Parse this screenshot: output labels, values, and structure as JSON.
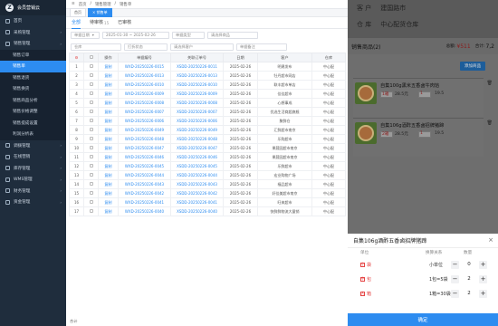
{
  "app": {
    "logo_text": "会员营销云"
  },
  "sidebar": {
    "items": [
      {
        "label": "首页"
      },
      {
        "label": "采购管理"
      },
      {
        "label": "销售管理"
      },
      {
        "label": "销售订单",
        "sub": true
      },
      {
        "label": "销售单",
        "sub": true,
        "active": true
      },
      {
        "label": "销售退货",
        "sub": true
      },
      {
        "label": "销售换货",
        "sub": true
      },
      {
        "label": "销售商品分析",
        "sub": true
      },
      {
        "label": "销售价格调整",
        "sub": true
      },
      {
        "label": "销售提成设置",
        "sub": true
      },
      {
        "label": "利润分析表",
        "sub": true
      },
      {
        "label": "调拨管理"
      },
      {
        "label": "在线营销"
      },
      {
        "label": "库存管理"
      },
      {
        "label": "WMS管理"
      },
      {
        "label": "财务管理"
      },
      {
        "label": "资金管理"
      }
    ]
  },
  "topbar": {
    "crumbs": [
      "首页",
      "/",
      "销售管理",
      "/",
      "销售单"
    ]
  },
  "tabs": [
    "首页",
    "× 销售单"
  ],
  "subtabs": [
    "全部",
    "待审核",
    "已审核"
  ],
  "subtab_badge": "15",
  "filters": {
    "date_type": "单据日期",
    "date_range": "2025-01-30  ~  2025-02-26",
    "bill_type": "单据类型",
    "keyword_ph": "请选择商品",
    "warehouse": "仓库",
    "status": "打折状态",
    "customer_ph": "请选择客户",
    "remark_ph": "单据备注"
  },
  "table": {
    "headers": [
      "",
      "",
      "操作",
      "单据编号",
      "关联订单号",
      "日期",
      "客户",
      "仓库"
    ],
    "rows": [
      [
        "1",
        "",
        "复制",
        "WXD-20250226-0015",
        "XSDD-20250226-0011",
        "2025-02-26",
        "明建发布",
        "中心配"
      ],
      [
        "2",
        "",
        "复制",
        "WXD-20250226-0013",
        "XSDD-20250226-0013",
        "2025-02-26",
        "牡丹超市网店",
        "中心配"
      ],
      [
        "3",
        "",
        "复制",
        "WXD-20250226-0010",
        "XSDD-20250226-0010",
        "2025-02-26",
        "联丰超市单店",
        "中心配"
      ],
      [
        "4",
        "",
        "复制",
        "WXD-20250226-0009",
        "XSDD-20250226-0009",
        "2025-02-26",
        "佳佳超市",
        "中心配"
      ],
      [
        "5",
        "",
        "复制",
        "WXD-20250226-0008",
        "XSDD-20250226-0008",
        "2025-02-26",
        "心想事成",
        "中心配"
      ],
      [
        "6",
        "",
        "复制",
        "WXD-20250226-0007",
        "XSDD-20250226-0007",
        "2025-02-26",
        "优选生活商超旗舰",
        "中心配"
      ],
      [
        "7",
        "",
        "复制",
        "WXD-20250226-0006",
        "XSDD-20250226-0006",
        "2025-02-26",
        "聚鲜仓",
        "中心配"
      ],
      [
        "8",
        "",
        "复制",
        "WXD-20250226-0049",
        "XSDD-20250226-0049",
        "2025-02-26",
        "汇鲜超市南京",
        "中心配"
      ],
      [
        "9",
        "",
        "复制",
        "WXD-20250226-0048",
        "XSDD-20250226-0048",
        "2025-02-26",
        "乐购超市",
        "中心配"
      ],
      [
        "10",
        "",
        "复制",
        "WXD-20250226-0047",
        "XSDD-20250226-0047",
        "2025-02-26",
        "果蔬园超市南京",
        "中心配"
      ],
      [
        "11",
        "",
        "复制",
        "WXD-20250226-0046",
        "XSDD-20250226-0046",
        "2025-02-26",
        "果蔬园超市南京",
        "中心配"
      ],
      [
        "12",
        "",
        "复制",
        "WXD-20250226-0045",
        "XSDD-20250226-0045",
        "2025-02-26",
        "乐鲜超市",
        "中心配"
      ],
      [
        "13",
        "",
        "复制",
        "WXD-20250226-0044",
        "XSDD-20250226-0044",
        "2025-02-26",
        "宏业购物广场",
        "中心配"
      ],
      [
        "14",
        "",
        "复制",
        "WXD-20250226-0043",
        "XSDD-20250226-0043",
        "2025-02-26",
        "福品超市",
        "中心配"
      ],
      [
        "15",
        "",
        "复制",
        "WXD-20250226-0042",
        "XSDD-20250226-0042",
        "2025-02-26",
        "好佳美超市南京",
        "中心配"
      ],
      [
        "16",
        "",
        "复制",
        "WXD-20250226-0041",
        "XSDD-20250226-0041",
        "2025-02-26",
        "旺来超市",
        "中心配"
      ],
      [
        "17",
        "",
        "复制",
        "WXD-20250226-0040",
        "XSDD-20250226-0040",
        "2025-02-26",
        "快鲜鲜物流大量销",
        "中心配"
      ]
    ],
    "total_label": "合计"
  },
  "overlay": {
    "customer_label": "客  户",
    "customer_value": "建国路市",
    "warehouse_label": "仓  库",
    "warehouse_value": "中心配货仓库",
    "goods_title": "销售商品(2)",
    "total_label": "总额:",
    "total_value": "¥511",
    "qty_label": "合计:",
    "qty_value": "7,2",
    "add_button": "添加商品",
    "products": [
      {
        "name": "自集100g黑米五香卤牛肉馅",
        "tag1": "1箱",
        "price1": "28.5元",
        "tag2": "1",
        "price2": "19.5"
      },
      {
        "name": "自集106g酒酢五香卤招牌猪蹄",
        "tag1": "2箱",
        "price1": "28.5元",
        "tag2": "1",
        "price2": "19.5"
      }
    ]
  },
  "sheet": {
    "title": "自集106g酒酢五香卤招牌猪蹄",
    "cols": [
      "单位",
      "换算关系",
      "数量"
    ],
    "rows": [
      {
        "icon": "小",
        "unit": "袋",
        "rel": "小单位",
        "qty": "0"
      },
      {
        "icon": "中",
        "unit": "包",
        "rel": "1包=5袋",
        "qty": "2"
      },
      {
        "icon": "大",
        "unit": "箱",
        "rel": "1箱=30袋",
        "qty": "2"
      }
    ],
    "confirm": "确定"
  }
}
